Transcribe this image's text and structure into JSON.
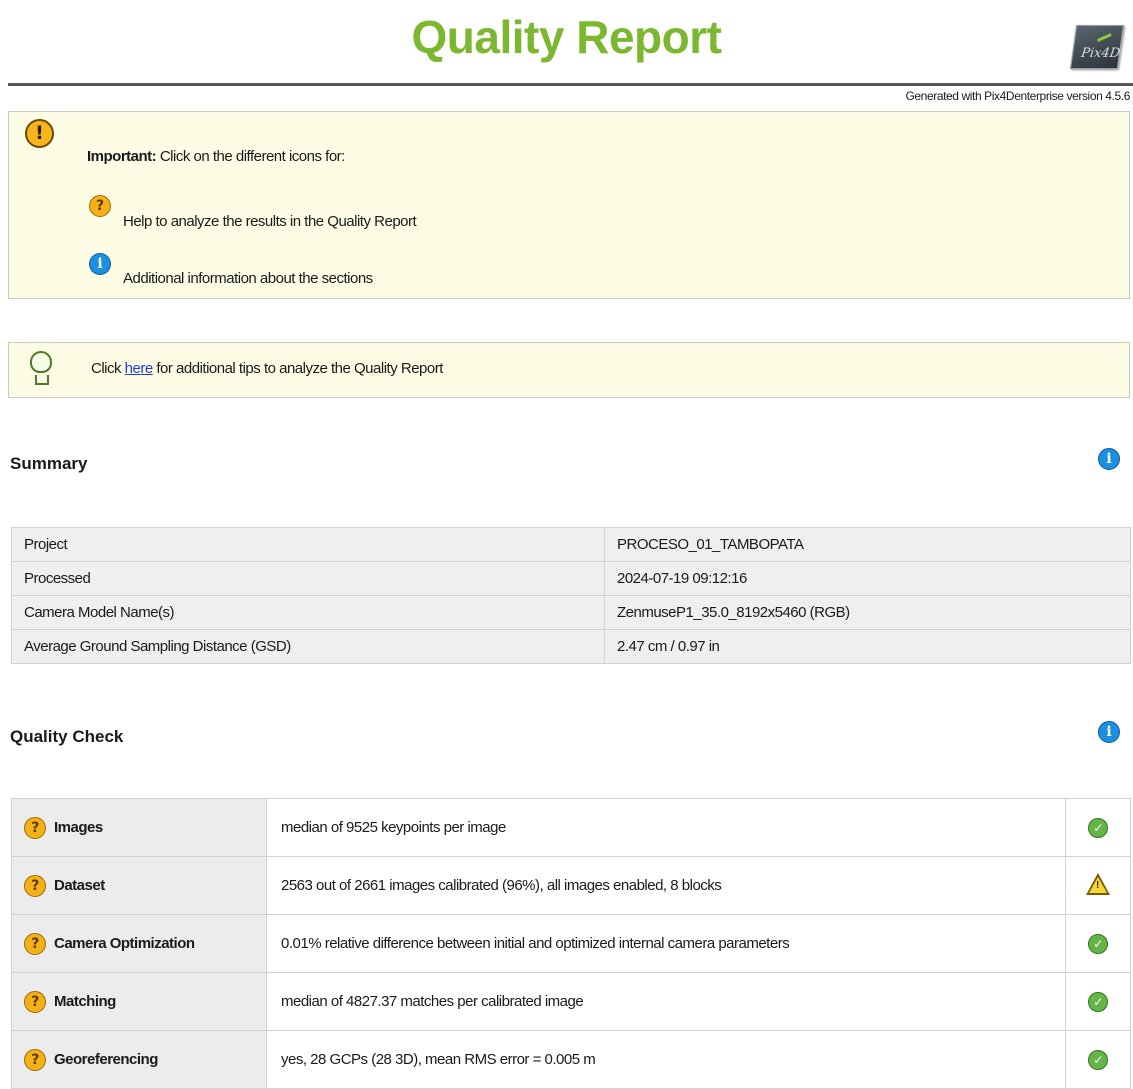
{
  "header": {
    "title": "Quality Report",
    "logo_text": "Pix4D",
    "generated": "Generated with Pix4Denterprise version 4.5.6"
  },
  "important_box": {
    "lead_bold": "Important:",
    "lead_text": " Click on the different icons for:",
    "help_text": "Help to analyze the results in the Quality Report",
    "info_text": "Additional information about the sections"
  },
  "tips_box": {
    "before": "Click ",
    "link": "here",
    "after": " for additional tips to analyze the Quality Report"
  },
  "summary": {
    "title": "Summary",
    "rows": [
      {
        "label": "Project",
        "value": "PROCESO_01_TAMBOPATA"
      },
      {
        "label": "Processed",
        "value": "2024-07-19 09:12:16"
      },
      {
        "label": "Camera Model Name(s)",
        "value": "ZenmuseP1_35.0_8192x5460 (RGB)"
      },
      {
        "label": "Average Ground Sampling Distance (GSD)",
        "value": "2.47 cm / 0.97 in"
      }
    ]
  },
  "quality_check": {
    "title": "Quality Check",
    "rows": [
      {
        "label": "Images",
        "value": "median of 9525 keypoints per image",
        "status": "ok"
      },
      {
        "label": "Dataset",
        "value": "2563 out of 2661 images calibrated (96%), all images enabled, 8 blocks",
        "status": "warning"
      },
      {
        "label": "Camera Optimization",
        "value": "0.01% relative difference between initial and optimized internal camera parameters",
        "status": "ok"
      },
      {
        "label": "Matching",
        "value": "median of 4827.37 matches per calibrated image",
        "status": "ok"
      },
      {
        "label": "Georeferencing",
        "value": "yes, 28 GCPs (28 3D), mean RMS error = 0.005 m",
        "status": "ok"
      }
    ]
  },
  "icons": {
    "important": "exclamation-icon",
    "help": "question-icon",
    "info": "info-icon",
    "tips": "lightbulb-icon",
    "ok": "check-circle-icon",
    "warning": "warning-triangle-icon"
  },
  "colors": {
    "title_green": "#7cb82f",
    "note_bg": "#fdfde6",
    "link_blue": "#1a3bd8",
    "ok_green": "#64b547",
    "warn_yellow": "#f8d53a",
    "info_blue": "#1d8ee0",
    "help_orange": "#f4b016"
  }
}
